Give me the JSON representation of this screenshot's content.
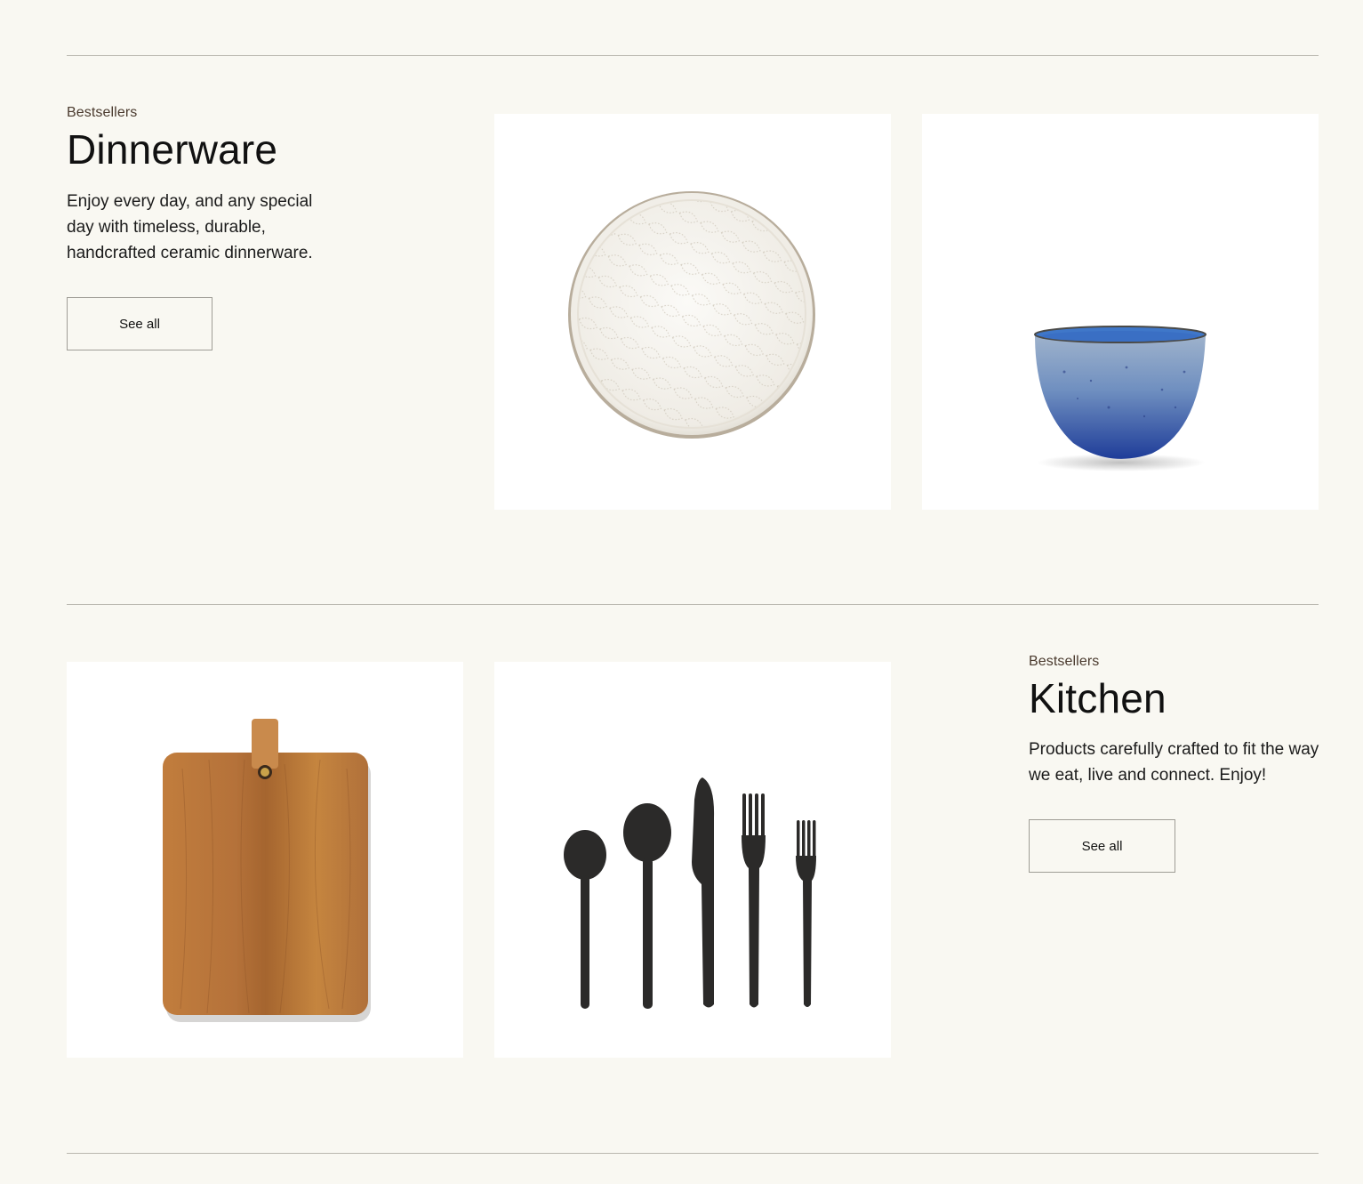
{
  "sections": [
    {
      "eyebrow": "Bestsellers",
      "title": "Dinnerware",
      "description": "Enjoy every day, and any special day with timeless, durable, handcrafted ceramic dinnerware.",
      "button_label": "See all",
      "products": [
        {
          "icon": "plate-image"
        },
        {
          "icon": "bowl-image"
        }
      ]
    },
    {
      "eyebrow": "Bestsellers",
      "title": "Kitchen",
      "description": "Products carefully crafted to fit the way we eat, live and connect. Enjoy!",
      "button_label": "See all",
      "products": [
        {
          "icon": "cutting-board-image"
        },
        {
          "icon": "flatware-set-image"
        }
      ]
    }
  ],
  "colors": {
    "background": "#f9f8f2",
    "card": "#ffffff",
    "eyebrow": "#4a3a2e",
    "bowl_blue": "#2e4fa8",
    "wood": "#b5753a",
    "flatware": "#2b2a29"
  }
}
